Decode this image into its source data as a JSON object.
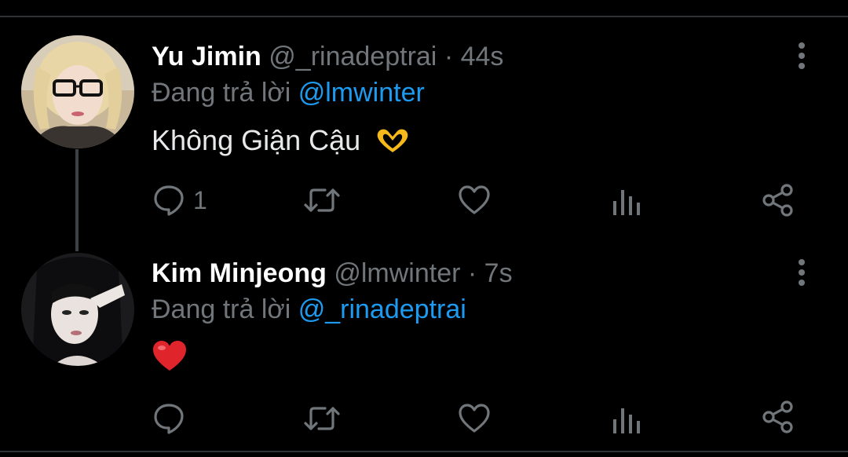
{
  "tweets": [
    {
      "name": "Yu Jimin",
      "handle": "@_rinadeptrai",
      "dot": "·",
      "time": "44s",
      "reply_prefix": "Đang trả lời",
      "reply_to": "@lmwinter",
      "text": "Không Giận Cậu",
      "emoji": "heart-hands-icon",
      "reply_count": "1"
    },
    {
      "name": "Kim Minjeong",
      "handle": "@lmwinter",
      "dot": "·",
      "time": "7s",
      "reply_prefix": "Đang trả lời",
      "reply_to": "@_rinadeptrai",
      "text": "",
      "emoji": "red-heart-icon",
      "reply_count": ""
    }
  ],
  "colors": {
    "background": "#000000",
    "name": "#ffffff",
    "secondary": "#71767b",
    "link": "#1d9bf0"
  }
}
